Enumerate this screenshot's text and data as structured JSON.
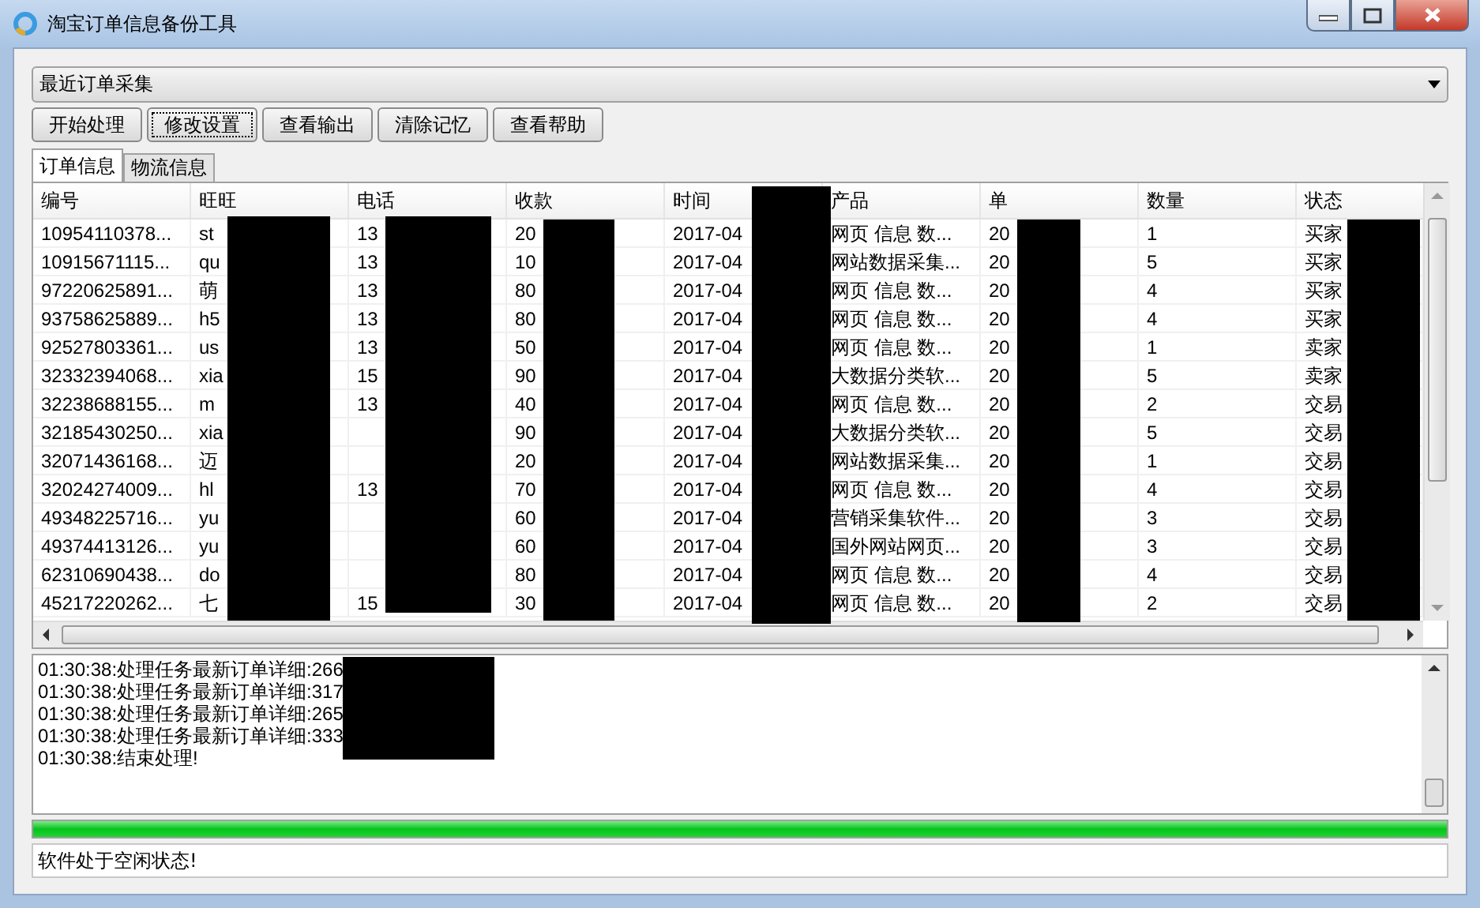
{
  "window": {
    "title": "淘宝订单信息备份工具"
  },
  "dropdown": {
    "value": "最近订单采集"
  },
  "buttons": [
    {
      "label": "开始处理",
      "focused": false
    },
    {
      "label": "修改设置",
      "focused": true
    },
    {
      "label": "查看输出",
      "focused": false
    },
    {
      "label": "清除记忆",
      "focused": false
    },
    {
      "label": "查看帮助",
      "focused": false
    }
  ],
  "tabs": [
    {
      "label": "订单信息",
      "selected": true
    },
    {
      "label": "物流信息",
      "selected": false
    }
  ],
  "table": {
    "columns": [
      "编号",
      "旺旺",
      "电话",
      "收款",
      "时间",
      "产品",
      "单",
      "数量",
      "状态"
    ],
    "rows": [
      [
        "10954110378...",
        "st",
        "13",
        "20",
        "2017-04",
        "网页 信息 数...",
        "20",
        "1",
        "买家"
      ],
      [
        "10915671115...",
        "qu",
        "13",
        "10",
        "2017-04",
        "网站数据采集...",
        "20",
        "5",
        "买家"
      ],
      [
        "97220625891...",
        "萌",
        "13",
        "80",
        "2017-04",
        "网页 信息 数...",
        "20",
        "4",
        "买家"
      ],
      [
        "93758625889...",
        "h5",
        "13",
        "80",
        "2017-04",
        "网页 信息 数...",
        "20",
        "4",
        "买家"
      ],
      [
        "92527803361...",
        "us",
        "13",
        "50",
        "2017-04",
        "网页 信息 数...",
        "20",
        "1",
        "卖家"
      ],
      [
        "32332394068...",
        "xia",
        "15",
        "90",
        "2017-04",
        "大数据分类软...",
        "20",
        "5",
        "卖家"
      ],
      [
        "32238688155...",
        "m",
        "13",
        "40",
        "2017-04",
        "网页 信息 数...",
        "20",
        "2",
        "交易"
      ],
      [
        "32185430250...",
        "xia",
        "",
        "90",
        "2017-04",
        "大数据分类软...",
        "20",
        "5",
        "交易"
      ],
      [
        "32071436168...",
        "迈",
        "",
        "20",
        "2017-04",
        "网站数据采集...",
        "20",
        "1",
        "交易"
      ],
      [
        "32024274009...",
        "hl",
        "13",
        "70",
        "2017-04",
        "网页 信息 数...",
        "20",
        "4",
        "交易"
      ],
      [
        "49348225716...",
        "yu",
        "",
        "60",
        "2017-04",
        "营销采集软件...",
        "20",
        "3",
        "交易"
      ],
      [
        "49374413126...",
        "yu",
        "",
        "60",
        "2017-04",
        "国外网站网页...",
        "20",
        "3",
        "交易"
      ],
      [
        "62310690438...",
        "do",
        "",
        "80",
        "2017-04",
        "网页 信息 数...",
        "20",
        "4",
        "交易"
      ],
      [
        "45217220262...",
        "七",
        "15",
        "30",
        "2017-04",
        "网页 信息 数...",
        "20",
        "2",
        "交易"
      ]
    ]
  },
  "log": {
    "lines": [
      "01:30:38:处理任务最新订单详细:266",
      "01:30:38:处理任务最新订单详细:317",
      "01:30:38:处理任务最新订单详细:265",
      "01:30:38:处理任务最新订单详细:333",
      "01:30:38:结束处理!"
    ]
  },
  "progress": {
    "level": 1
  },
  "status": {
    "value": "软件处于空闲状态!"
  }
}
